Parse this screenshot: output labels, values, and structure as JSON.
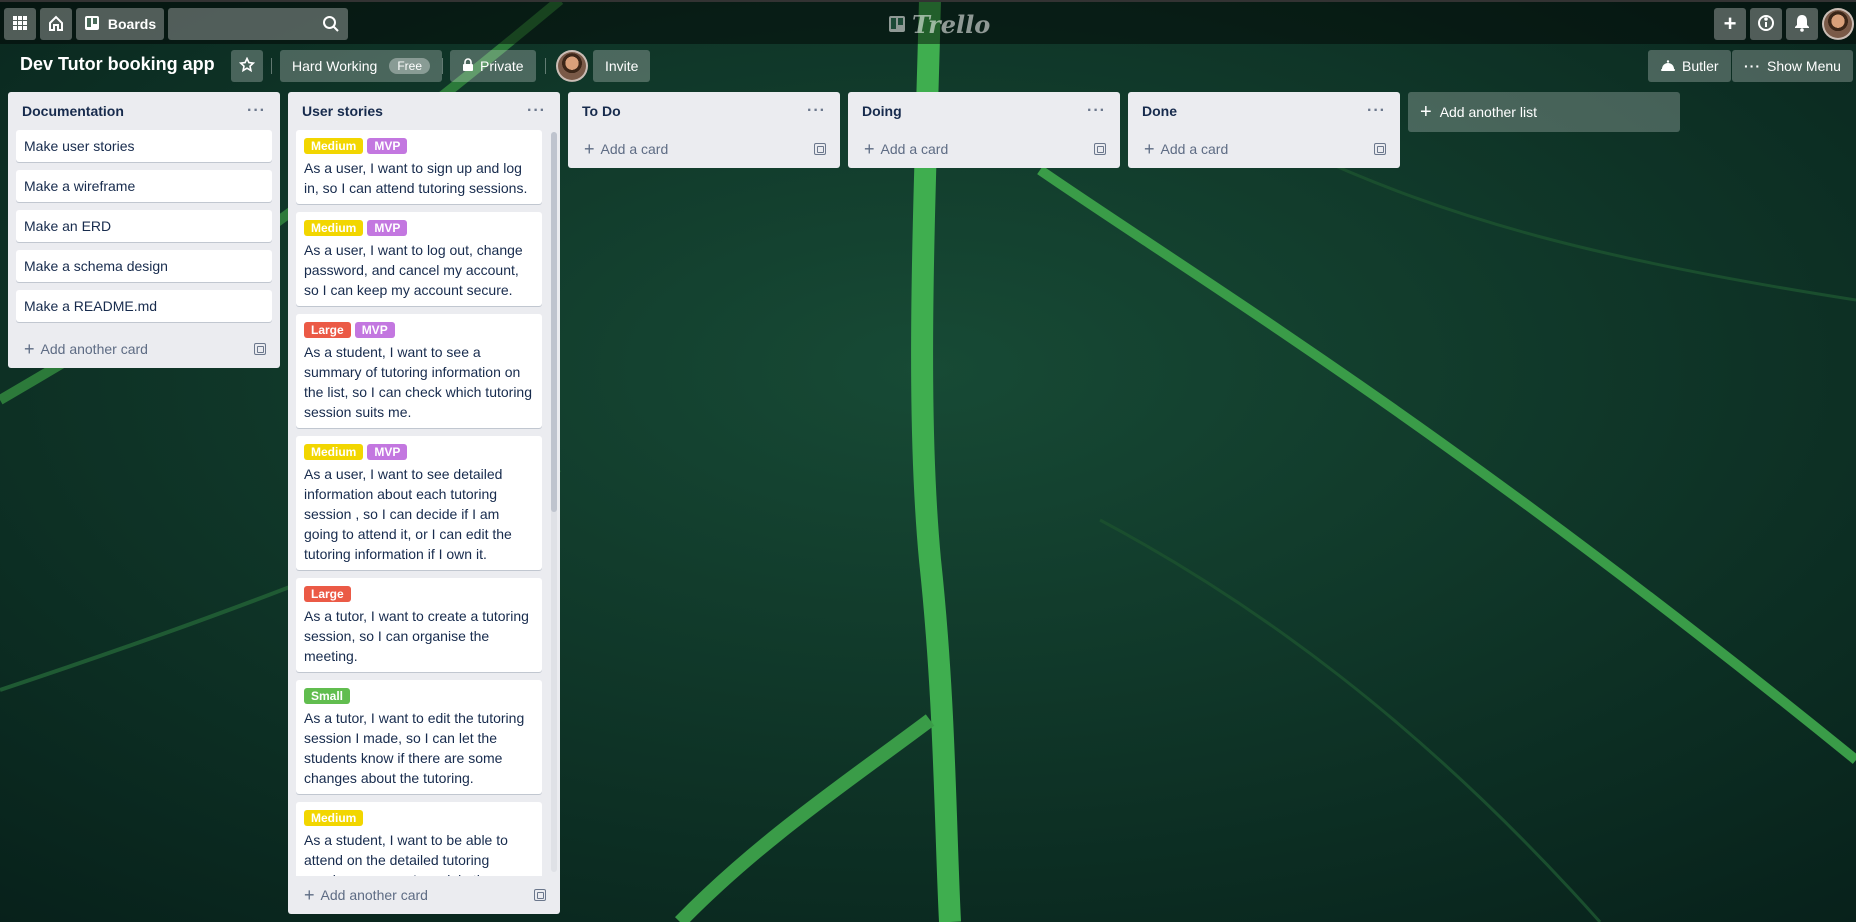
{
  "nav": {
    "boards_label": "Boards",
    "search_value": "",
    "logo_text": "Trello"
  },
  "board": {
    "title": "Dev Tutor booking app",
    "workspace_label": "Hard Working",
    "workspace_badge": "Free",
    "visibility_label": "Private",
    "invite_label": "Invite",
    "butler_label": "Butler",
    "show_menu_label": "Show Menu"
  },
  "lists": {
    "documentation": {
      "title": "Documentation",
      "cards": [
        "Make user stories",
        "Make a wireframe",
        "Make an ERD",
        "Make a schema design",
        "Make a README.md"
      ],
      "footer": "Add another card"
    },
    "user_stories": {
      "title": "User stories",
      "cards": [
        {
          "labels": [
            "Medium",
            "MVP"
          ],
          "text": "As a user, I want to sign up and log in, so I can attend tutoring sessions."
        },
        {
          "labels": [
            "Medium",
            "MVP"
          ],
          "text": "As a user, I want to log out, change password, and cancel my account, so I can keep my account secure."
        },
        {
          "labels": [
            "Large",
            "MVP"
          ],
          "text": "As a student, I want to see a summary of tutoring information on the list, so I can check which tutoring session suits me."
        },
        {
          "labels": [
            "Medium",
            "MVP"
          ],
          "text": "As a user, I want to see detailed information about each tutoring session , so I can decide if I am going to attend it, or I can edit the tutoring information if I own it."
        },
        {
          "labels": [
            "Large"
          ],
          "text": "As a tutor, I want to create a tutoring session, so I can organise the meeting."
        },
        {
          "labels": [
            "Small"
          ],
          "text": "As a tutor, I want to edit the tutoring session I made, so I can let the students know if there are some changes about the tutoring."
        },
        {
          "labels": [
            "Medium"
          ],
          "text": "As a student, I want to be able to attend on the detailed tutoring session page, so I can join the"
        }
      ],
      "footer": "Add another card"
    },
    "todo": {
      "title": "To Do",
      "footer": "Add a card"
    },
    "doing": {
      "title": "Doing",
      "footer": "Add a card"
    },
    "done": {
      "title": "Done",
      "footer": "Add a card"
    }
  },
  "add_list_label": "Add another list",
  "colors": {
    "label_medium": "#f2d600",
    "label_mvp": "#c377e0",
    "label_large": "#eb5a46",
    "label_small": "#61bd4f",
    "background": "#0d2f22"
  },
  "icons": [
    "apps-icon",
    "home-icon",
    "boards-icon",
    "search-icon",
    "trello-logo-icon",
    "plus-icon",
    "info-icon",
    "bell-icon",
    "star-icon",
    "lock-icon",
    "butler-icon",
    "ellipsis-icon",
    "card-template-icon"
  ]
}
